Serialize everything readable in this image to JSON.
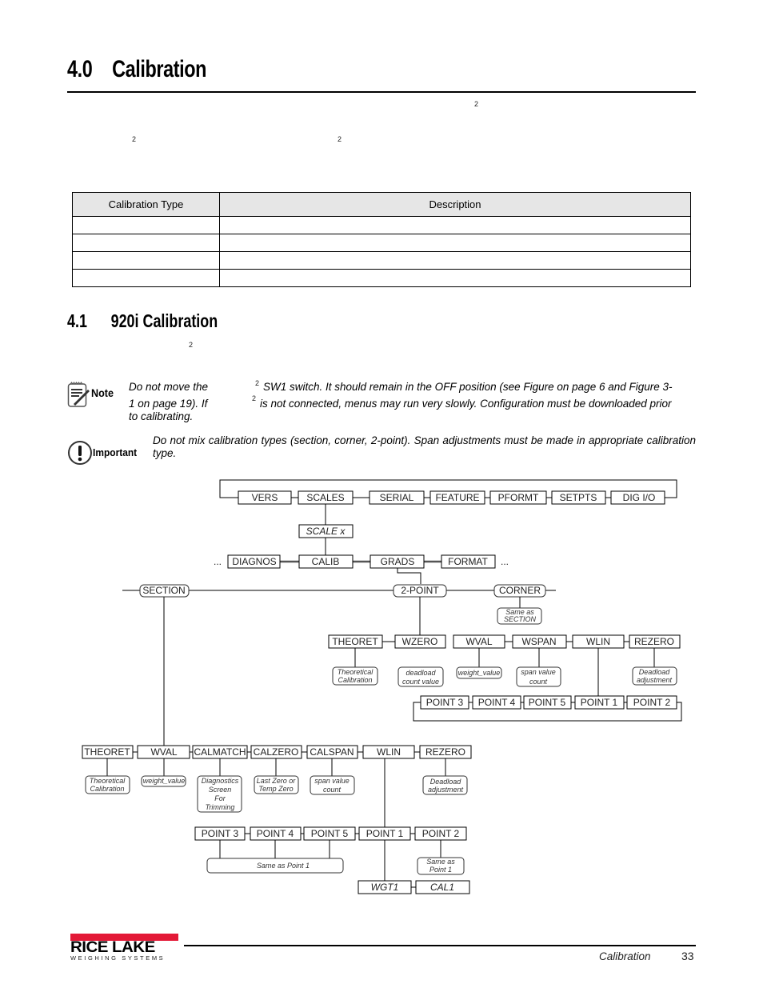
{
  "heading": {
    "number": "4.0",
    "title": "Calibration"
  },
  "intro_superscripts": [
    "2",
    "2",
    "2"
  ],
  "table": {
    "headers": [
      "Calibration Type",
      "Description"
    ],
    "rows": [
      [
        "",
        ""
      ],
      [
        "",
        ""
      ],
      [
        "",
        ""
      ],
      [
        "",
        ""
      ]
    ]
  },
  "section": {
    "number": "4.1",
    "title": "920i Calibration",
    "superscript": "2"
  },
  "note": {
    "label": "Note",
    "col1": [
      "Do not move the",
      "1 on page 19). If",
      "to calibrating."
    ],
    "sup": "2",
    "line1": "SW1 switch. It should remain in the OFF position (see Figure  on page 6 and Figure 3-",
    "line2": "is not connected, menus may run very slowly. Configuration must be downloaded prior"
  },
  "important": {
    "label": "Important",
    "text": "Do not mix calibration types (section, corner, 2-point). Span adjustments must be made in appropriate calibration type."
  },
  "diagram": {
    "top_menu": [
      "VERS",
      "SCALES",
      "SERIAL",
      "FEATURE",
      "PFORMT",
      "SETPTS",
      "DIG I/O"
    ],
    "scale_x": "SCALE x",
    "ellipsis": "...",
    "scale_menu": [
      "DIAGNOS",
      "CALIB",
      "GRADS",
      "FORMAT"
    ],
    "cal_types": [
      "SECTION",
      "2-POINT",
      "CORNER"
    ],
    "corner_note": [
      "Same as",
      "SECTION"
    ],
    "two_point": {
      "items": [
        "THEORET",
        "WZERO",
        "WVAL",
        "WSPAN",
        "WLIN",
        "REZERO"
      ],
      "notes": {
        "theoret": [
          "Theoretical",
          "Calibration"
        ],
        "wzero": [
          "deadload",
          "count value"
        ],
        "wval": [
          "weight_value"
        ],
        "wspan": [
          "span value",
          "count"
        ],
        "rezero": [
          "Deadload",
          "adjustment"
        ]
      },
      "points": [
        "POINT 3",
        "POINT 4",
        "POINT 5",
        "POINT 1",
        "POINT 2"
      ]
    },
    "section": {
      "items": [
        "THEORET",
        "WVAL",
        "CALMATCH",
        "CALZERO",
        "CALSPAN",
        "WLIN",
        "REZERO"
      ],
      "notes": {
        "theoret": [
          "Theoretical",
          "Calibration"
        ],
        "wval": [
          "weight_value"
        ],
        "calmatch": [
          "Diagnostics",
          "Screen",
          "For",
          "Trimming"
        ],
        "calzero": [
          "Last Zero or",
          "Temp Zero"
        ],
        "calspan": [
          "span value",
          "count"
        ],
        "rezero": [
          "Deadload",
          "adjustment"
        ]
      },
      "points": [
        "POINT 3",
        "POINT 4",
        "POINT 5",
        "POINT 1",
        "POINT 2"
      ],
      "points_note": "Same as Point 1",
      "point2_note": [
        "Same as",
        "Point 1"
      ],
      "point1_children": [
        "WGT1",
        "CAL1"
      ]
    }
  },
  "footer": {
    "logo_main": "RICE LAKE",
    "logo_sub": "WEIGHING SYSTEMS",
    "section": "Calibration",
    "page": "33",
    "brand_color": "#e31937"
  }
}
